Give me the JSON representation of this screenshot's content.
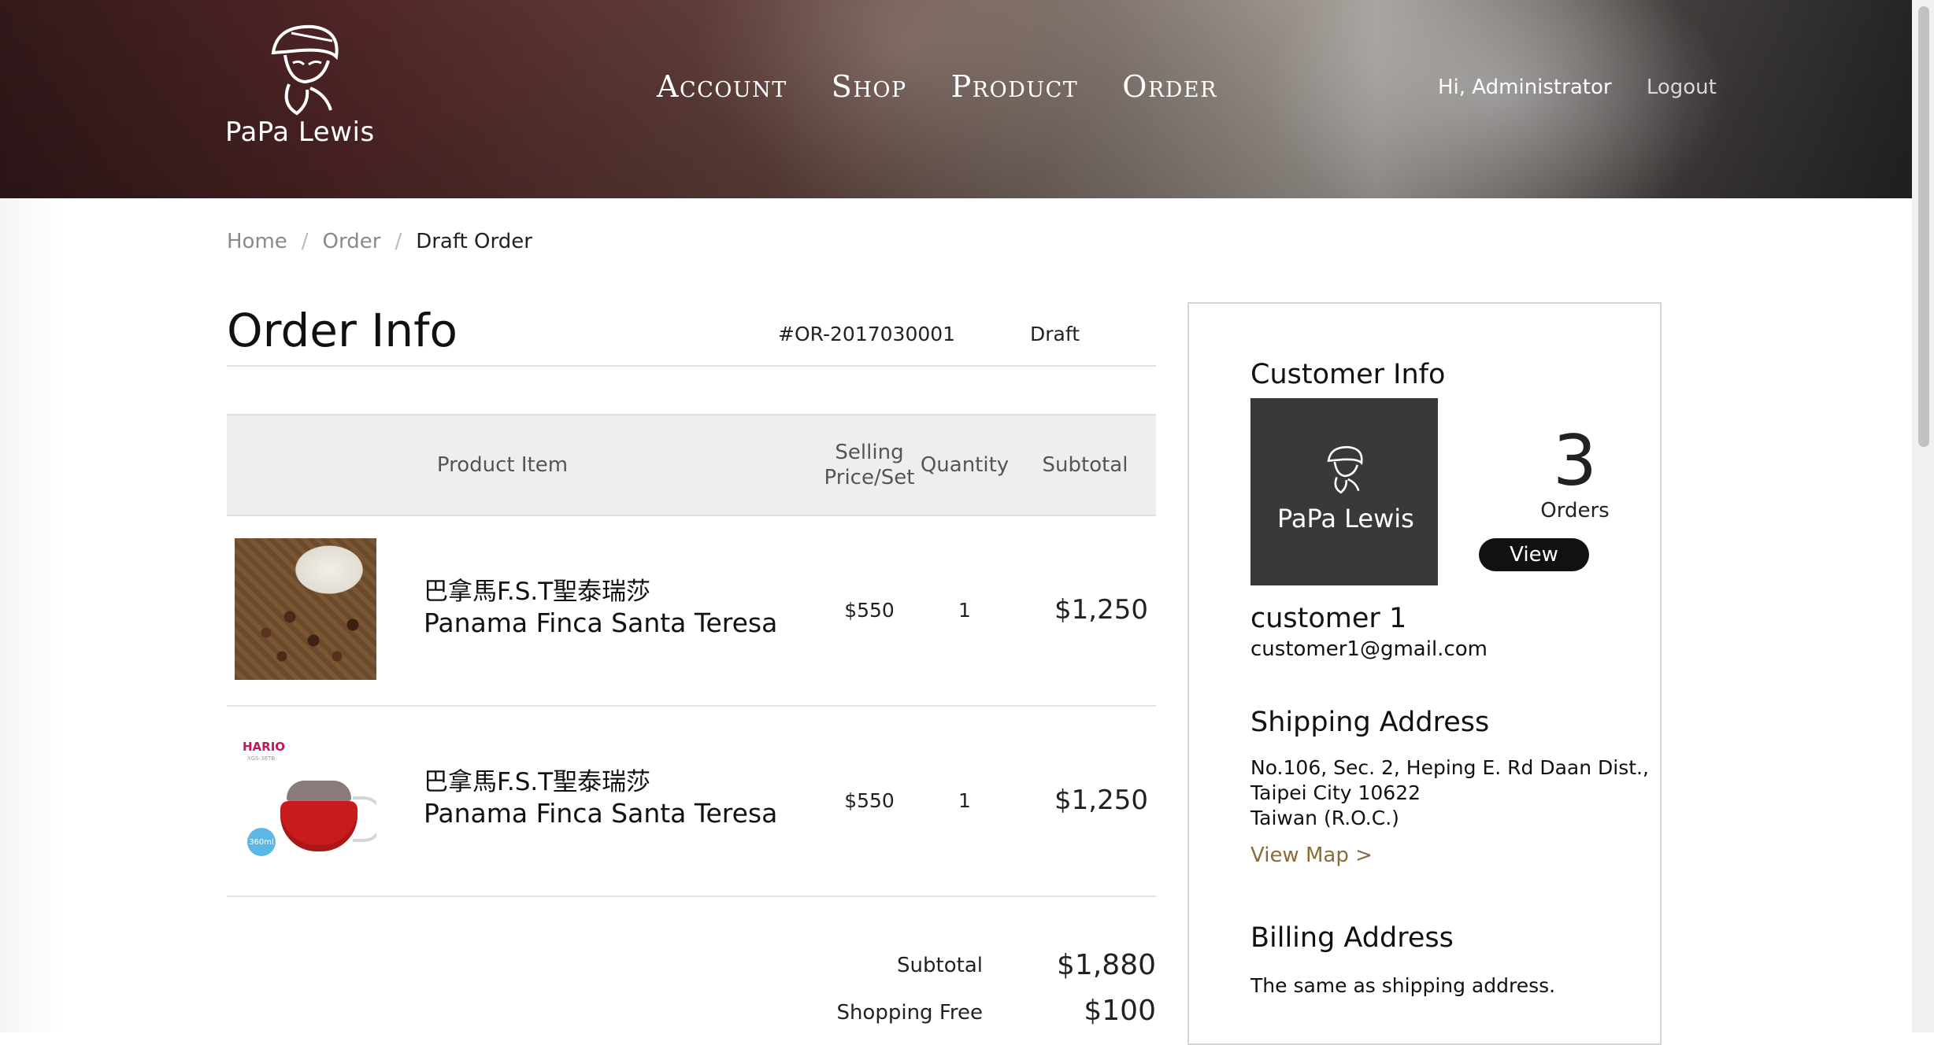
{
  "header": {
    "brand": "PaPa Lewis",
    "nav": [
      "Account",
      "Shop",
      "Product",
      "Order"
    ],
    "greeting": "Hi, Administrator",
    "logout": "Logout"
  },
  "breadcrumb": {
    "items": [
      "Home",
      "Order",
      "Draft Order"
    ]
  },
  "order": {
    "title": "Order Info",
    "number": "#OR-2017030001",
    "status": "Draft"
  },
  "table": {
    "headers": {
      "item": "Product Item",
      "price": "Selling Price/Set",
      "quantity": "Quantity",
      "subtotal": "Subtotal"
    },
    "rows": [
      {
        "name_zh": "巴拿馬F.S.T聖泰瑞莎",
        "name_en": "Panama Finca Santa Teresa",
        "price": "$550",
        "quantity": "1",
        "subtotal": "$1,250",
        "image": "coffee-beans"
      },
      {
        "name_zh": "巴拿馬F.S.T聖泰瑞莎",
        "name_en": "Panama Finca Santa Teresa",
        "price": "$550",
        "quantity": "1",
        "subtotal": "$1,250",
        "image": "hario-pot",
        "image_brand": "HARIO",
        "image_badge": "360ml"
      }
    ]
  },
  "totals": {
    "subtotal_label": "Subtotal",
    "subtotal": "$1,880",
    "shipping_label": "Shopping Free",
    "shipping": "$100"
  },
  "customer": {
    "heading": "Customer Info",
    "avatar_brand": "PaPa Lewis",
    "orders_count": "3",
    "orders_label": "Orders",
    "view_label": "View",
    "name": "customer 1",
    "email": "customer1@gmail.com",
    "shipping_heading": "Shipping Address",
    "address_lines": [
      "No.106, Sec. 2, Heping E. Rd Daan Dist.,",
      "Taipei City 10622",
      "Taiwan (R.O.C.)"
    ],
    "view_map": "View Map >",
    "billing_heading": "Billing Address",
    "billing_text": "The same as shipping address."
  },
  "colors": {
    "accent_link": "#8b6b3a",
    "button_bg": "#111111",
    "table_header_bg": "#eeeeee"
  }
}
